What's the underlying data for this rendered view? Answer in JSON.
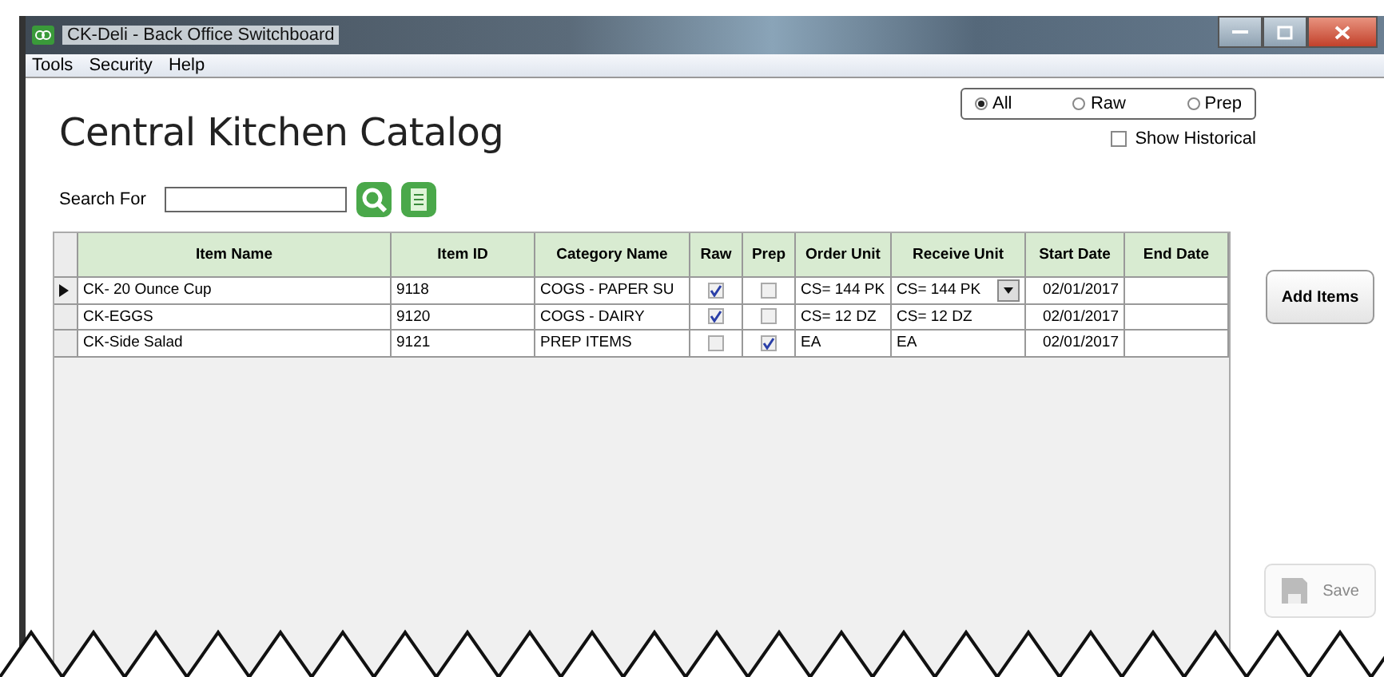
{
  "window": {
    "title": "CK-Deli - Back Office Switchboard"
  },
  "menu": [
    "Tools",
    "Security",
    "Help"
  ],
  "heading": "Central Kitchen Catalog",
  "filter": [
    {
      "label": "All",
      "selected": true
    },
    {
      "label": "Raw",
      "selected": false
    },
    {
      "label": "Prep",
      "selected": false
    }
  ],
  "show_historical": {
    "label": "Show Historical",
    "checked": false
  },
  "search": {
    "label": "Search For"
  },
  "table": {
    "columns": [
      "Item Name",
      "Item ID",
      "Category Name",
      "Raw",
      "Prep",
      "Order Unit",
      "Receive Unit",
      "Start Date",
      "End Date"
    ],
    "rows": [
      {
        "selected": true,
        "item_name": "CK- 20 Ounce Cup",
        "item_id": "9118",
        "category": "COGS - PAPER SU",
        "raw": true,
        "prep": false,
        "order_unit": "CS= 144 PK",
        "receive_unit": "CS= 144 PK",
        "receive_dropdown": true,
        "start_date": "02/01/2017"
      },
      {
        "selected": false,
        "item_name": "CK-EGGS",
        "item_id": "9120",
        "category": "COGS - DAIRY",
        "raw": true,
        "prep": false,
        "order_unit": "CS= 12 DZ",
        "receive_unit": "CS= 12 DZ",
        "receive_dropdown": false,
        "start_date": "02/01/2017"
      },
      {
        "selected": false,
        "item_name": "CK-Side Salad",
        "item_id": "9121",
        "category": "PREP ITEMS",
        "raw": false,
        "prep": true,
        "order_unit": "EA",
        "receive_unit": "EA",
        "receive_dropdown": false,
        "start_date": "02/01/2017"
      }
    ]
  },
  "buttons": [
    {
      "label": "Add Items",
      "disabled": false
    },
    {
      "label": "Save",
      "disabled": true
    }
  ]
}
